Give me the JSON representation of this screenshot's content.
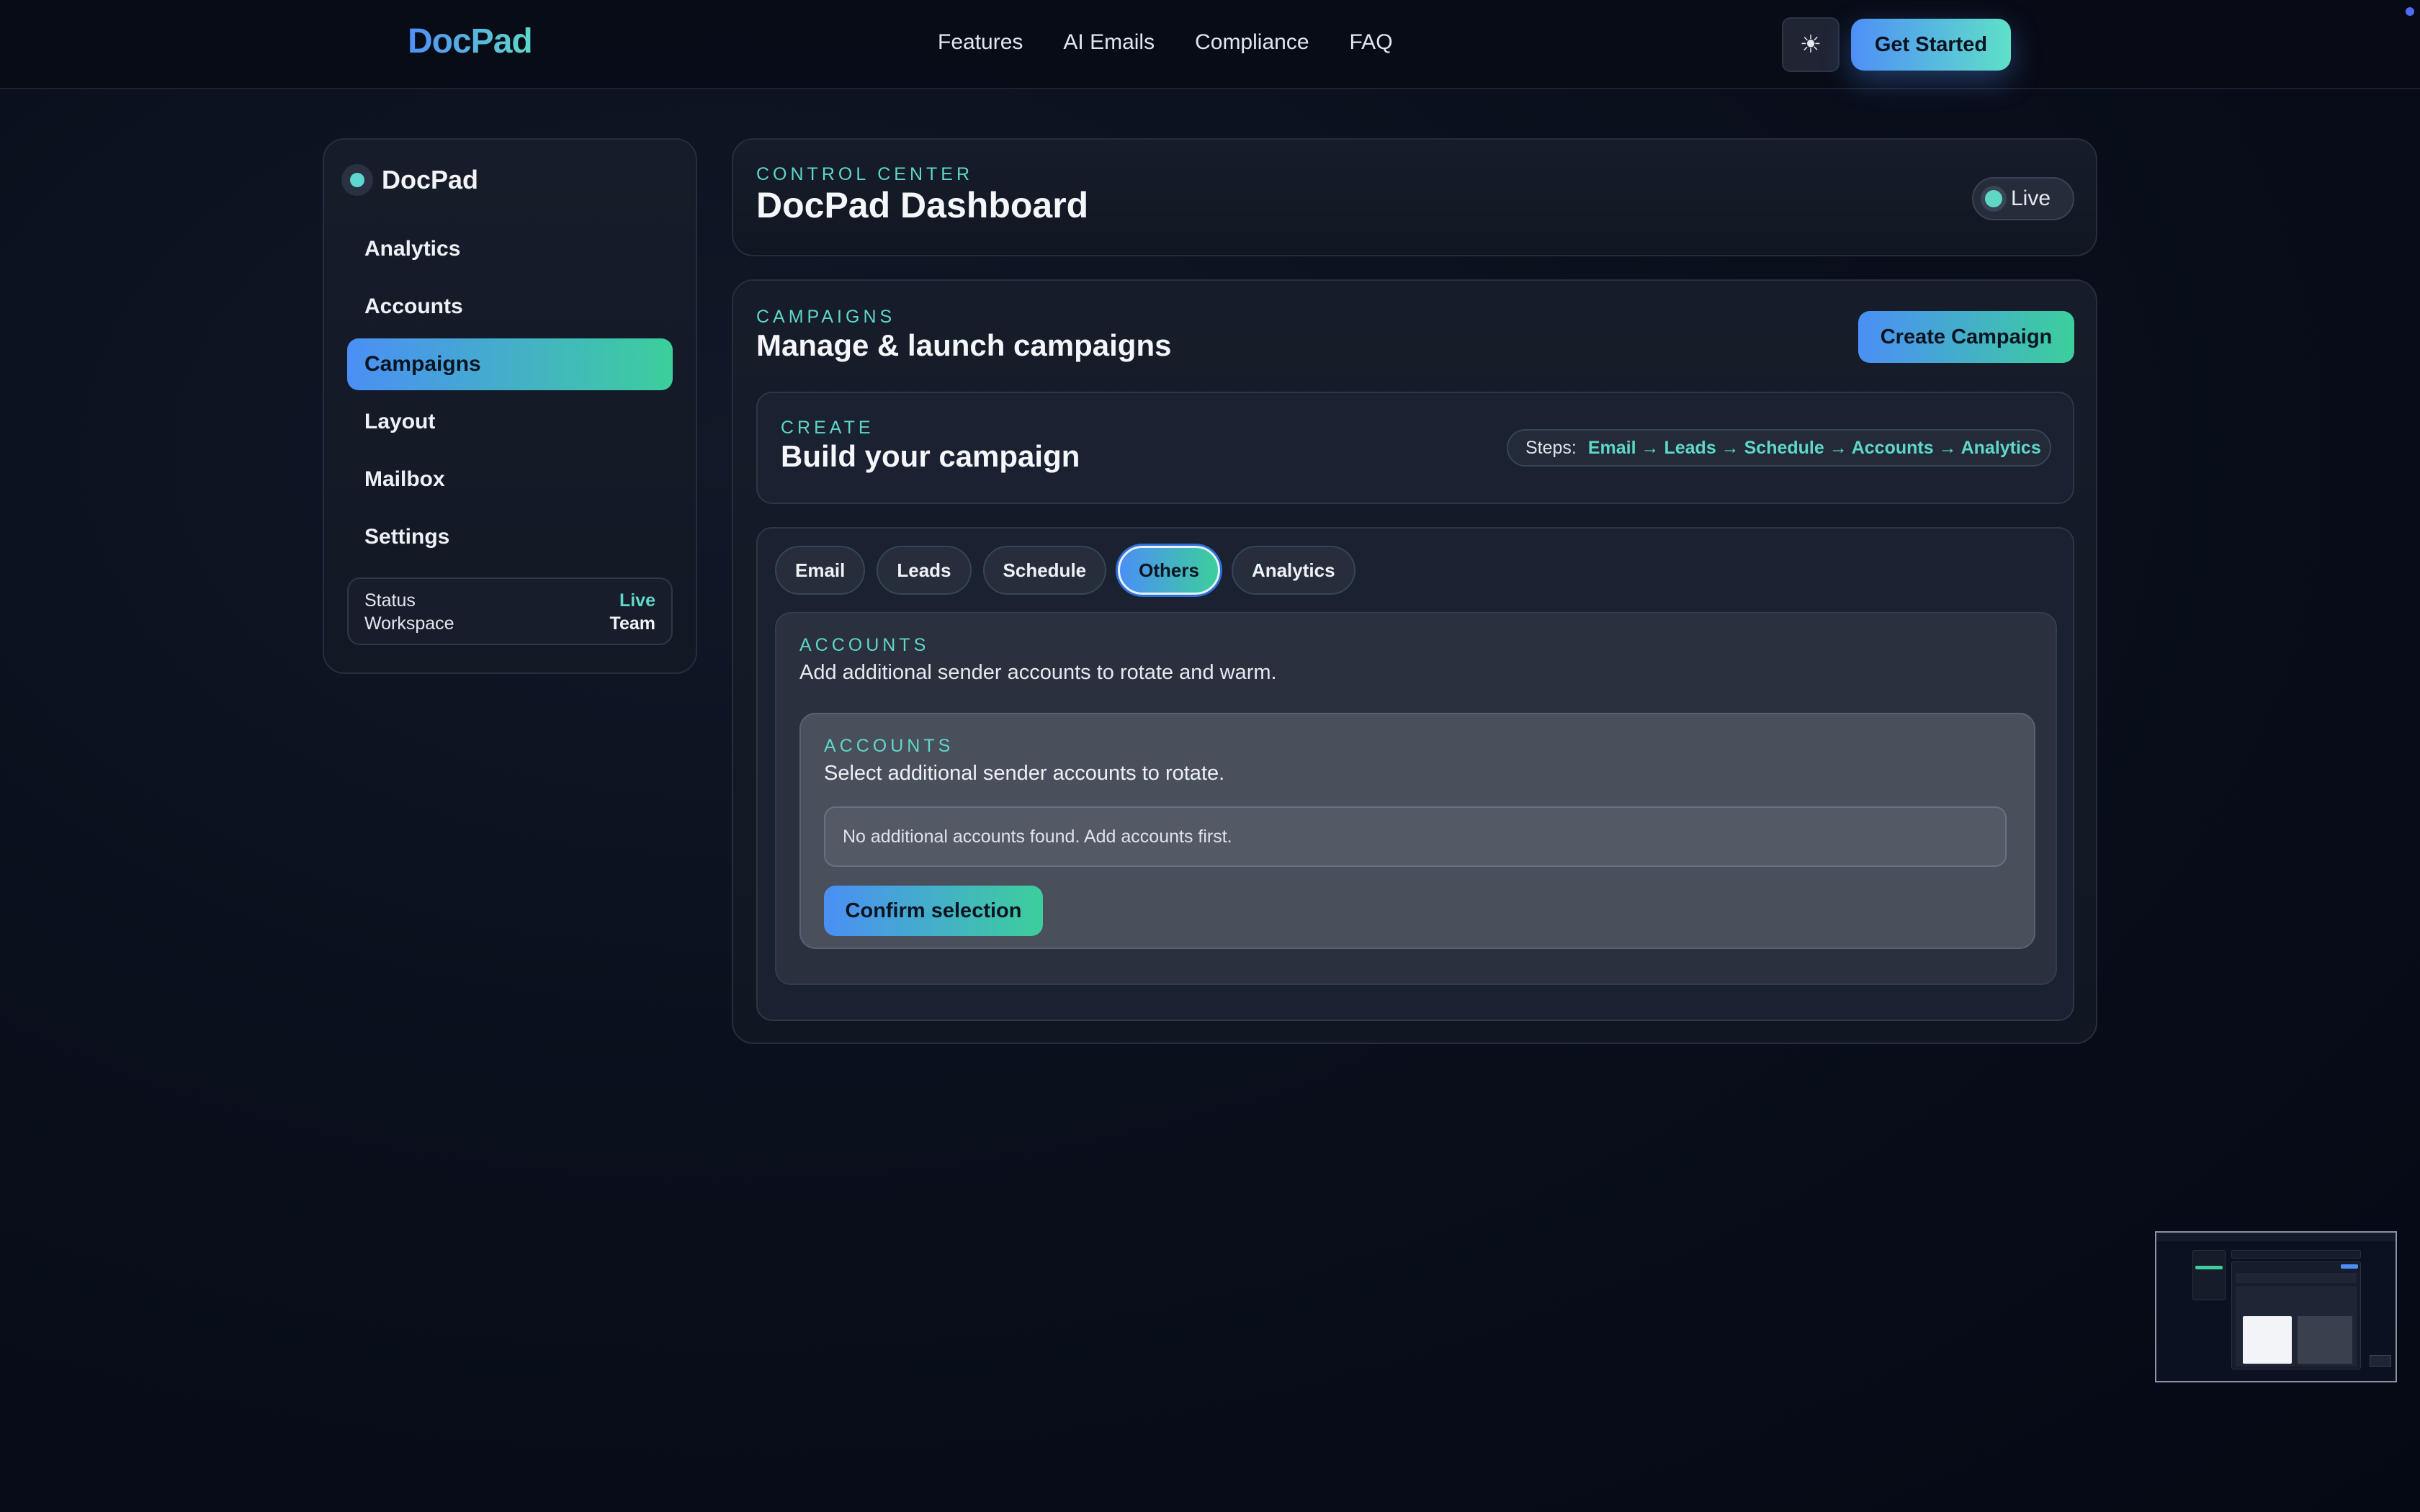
{
  "nav": {
    "brand": "DocPad",
    "links": [
      "Features",
      "AI Emails",
      "Compliance",
      "FAQ"
    ],
    "theme_icon": "sun-icon",
    "cta": "Get Started"
  },
  "sidebar": {
    "logo_text": "DocPad",
    "items": [
      {
        "label": "Analytics",
        "active": false
      },
      {
        "label": "Accounts",
        "active": false
      },
      {
        "label": "Campaigns",
        "active": true
      },
      {
        "label": "Layout",
        "active": false
      },
      {
        "label": "Mailbox",
        "active": false
      },
      {
        "label": "Settings",
        "active": false
      }
    ],
    "status": {
      "status_label": "Status",
      "status_value": "Live",
      "workspace_label": "Workspace",
      "workspace_value": "Team"
    }
  },
  "header": {
    "eyebrow": "CONTROL CENTER",
    "title": "DocPad Dashboard",
    "badge": "Live"
  },
  "campaigns": {
    "eyebrow": "CAMPAIGNS",
    "title": "Manage & launch campaigns",
    "create_button": "Create Campaign",
    "build": {
      "eyebrow": "CREATE",
      "title": "Build your campaign",
      "steps_label": "Steps:",
      "steps_sequence": "Email → Leads → Schedule → Accounts → Analytics"
    },
    "tabs": [
      {
        "label": "Email",
        "active": false
      },
      {
        "label": "Leads",
        "active": false
      },
      {
        "label": "Schedule",
        "active": false
      },
      {
        "label": "Others",
        "active": true
      },
      {
        "label": "Analytics",
        "active": false
      }
    ],
    "accounts": {
      "eyebrow": "ACCOUNTS",
      "description": "Add additional sender accounts to rotate and warm.",
      "inner": {
        "eyebrow": "ACCOUNTS",
        "description": "Select additional sender accounts to rotate.",
        "empty_message": "No additional accounts found. Add accounts first.",
        "confirm_button": "Confirm selection"
      }
    }
  },
  "colors": {
    "accent_blue": "#4b8ff5",
    "accent_teal": "#3ccf9c",
    "eyebrow": "#5fd7c9",
    "background": "#0a0f1c"
  }
}
